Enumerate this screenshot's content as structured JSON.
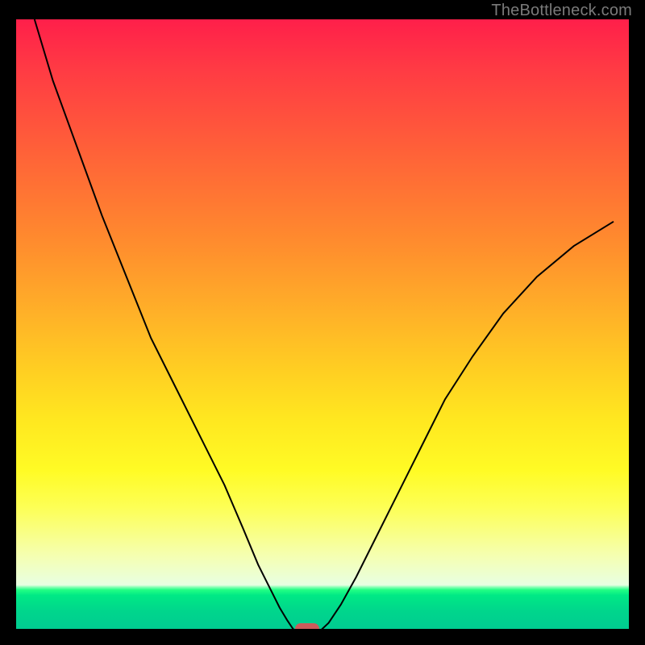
{
  "watermark": "TheBottleneck.com",
  "colors": {
    "background": "#000000",
    "curve": "#000000",
    "marker": "#cc5b5b",
    "watermark": "#7a7a7a"
  },
  "chart_data": {
    "type": "line",
    "title": "",
    "xlabel": "",
    "ylabel": "",
    "xlim": [
      0,
      100
    ],
    "ylim": [
      0,
      100
    ],
    "grid": false,
    "legend": false,
    "series": [
      {
        "name": "left-branch",
        "x": [
          3,
          6,
          10,
          14,
          18,
          22,
          26,
          30,
          34,
          37,
          39.5,
          41.5,
          43,
          44.2,
          45,
          45.6
        ],
        "values": [
          100,
          90,
          79,
          68,
          58,
          48,
          40,
          32,
          24,
          17,
          11,
          7,
          4,
          2,
          0.8,
          0
        ]
      },
      {
        "name": "flat-minimum",
        "x": [
          45.6,
          49.4
        ],
        "values": [
          0,
          0
        ]
      },
      {
        "name": "right-branch",
        "x": [
          49.4,
          51,
          53,
          55.5,
          58.5,
          62,
          66,
          70,
          74.5,
          79.5,
          85,
          91,
          97.5
        ],
        "values": [
          0,
          1.5,
          4.5,
          9,
          15,
          22,
          30,
          38,
          45,
          52,
          58,
          63,
          67
        ]
      }
    ],
    "marker": {
      "x": 47.5,
      "y": 0
    },
    "background_gradient": {
      "direction": "top-to-bottom",
      "stops": [
        {
          "pos": 0,
          "color": "#ff1f4a"
        },
        {
          "pos": 50,
          "color": "#ffb028"
        },
        {
          "pos": 80,
          "color": "#fdff55"
        },
        {
          "pos": 94,
          "color": "#00e985"
        },
        {
          "pos": 100,
          "color": "#00cc91"
        }
      ]
    }
  }
}
